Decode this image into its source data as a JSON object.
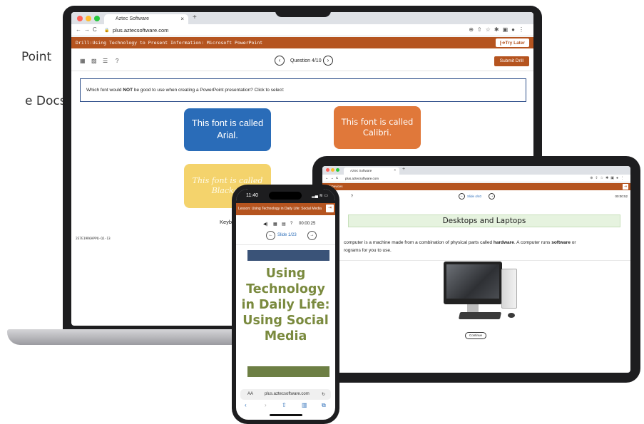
{
  "background_text": {
    "line1": "Point",
    "line2": "e Docs"
  },
  "laptop": {
    "browser": {
      "tab_title": "Aztec Software",
      "tab_close": "×",
      "new_tab": "+",
      "url": "plus.aztecsoftware.com"
    },
    "drill_title": "Drill:Using Technology to Present Information: Microsoft PowerPoint",
    "try_later": "[➔Try Later",
    "question_counter": "Question 4/10",
    "submit_label": "Submit Drill",
    "question": {
      "before": "Which font would ",
      "bold": "NOT",
      "after": " be good to use when creating a PowerPoint presentation? Click to select:"
    },
    "answers": {
      "arial": "This font is called Arial.",
      "calibri": "This font is called Calibri.",
      "blackadder": "This font is called Blackad"
    },
    "keyboard_text": "Keyb",
    "footer_code": "2E7E19R6APPQ-Q1-13"
  },
  "tablet": {
    "browser": {
      "tab_title": "Aztec Software",
      "tab_close": "×",
      "new_tab": "+",
      "url": "plus.aztecsoftware.com"
    },
    "lesson_title": "s of Devices",
    "help": "?",
    "slide_counter": "Slide 4/40",
    "timer": "00:00:52",
    "heading": "Desktops and Laptops",
    "paragraph": {
      "p1": "computer is a machine made from a combination of physical parts called ",
      "b1": "hardware",
      "p2": ". A computer runs ",
      "b2": "software",
      "p3": " or",
      "line2": "rograms for you to use."
    },
    "continue_label": "Continue"
  },
  "phone": {
    "time": "11:40",
    "status_icons": "▂▄ ≋ ▭",
    "lesson_title": "Lesson: Using Technology in Daily Life: Social Media",
    "help": "?",
    "timer": "00:00:25",
    "slide_counter": "Slide 1/23",
    "slide_title": "Using Technology in Daily Life: Using Social Media",
    "url_aa": "AA",
    "url": "plus.aztecsoftware.com",
    "reload": "↻"
  },
  "colors": {
    "brand_orange": "#b5541f",
    "arial_blue": "#2a6cb8",
    "calibri_orange": "#e0783a",
    "blackadder_yellow": "#f4d36c",
    "title_green": "#7a8a3e"
  }
}
